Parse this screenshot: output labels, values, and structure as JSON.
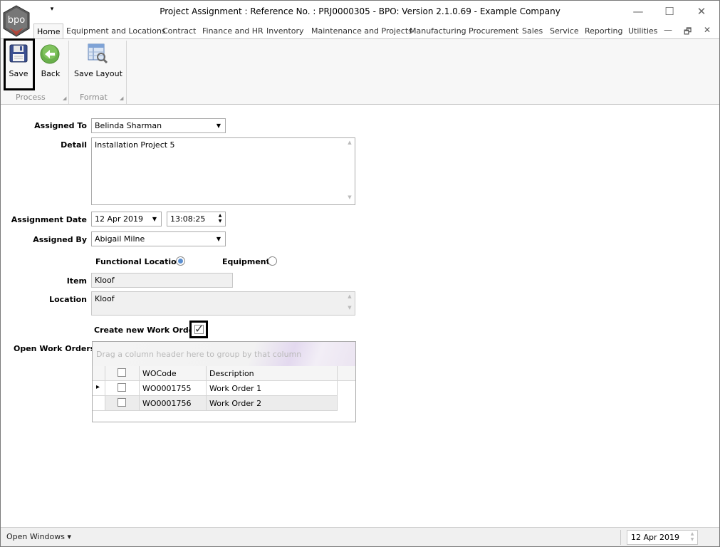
{
  "window": {
    "title": "Project Assignment : Reference No. : PRJ0000305 - BPO: Version 2.1.0.69 - Example Company",
    "logo_text": "bpo",
    "qat_arrow": "▾",
    "minimize": "—",
    "maximize": "☐",
    "close": "✕"
  },
  "tabs": [
    {
      "label": "Home"
    },
    {
      "label": "Equipment and Locations"
    },
    {
      "label": "Contract"
    },
    {
      "label": "Finance and HR"
    },
    {
      "label": "Inventory"
    },
    {
      "label": "Maintenance and Projects"
    },
    {
      "label": "Manufacturing"
    },
    {
      "label": "Procurement"
    },
    {
      "label": "Sales"
    },
    {
      "label": "Service"
    },
    {
      "label": "Reporting"
    },
    {
      "label": "Utilities"
    }
  ],
  "mdi_controls": {
    "minimize": "—",
    "restore": "🗗",
    "close": "✕"
  },
  "ribbon": {
    "save": "Save",
    "back": "Back",
    "save_layout": "Save Layout",
    "group_process": "Process",
    "group_format": "Format",
    "launcher": "◢"
  },
  "form": {
    "assigned_to_label": "Assigned To",
    "assigned_to_value": "Belinda Sharman",
    "detail_label": "Detail",
    "detail_value": "Installation Project 5",
    "assignment_date_label": "Assignment Date",
    "assignment_date_value": "12 Apr 2019",
    "assignment_time_value": "13:08:25",
    "assigned_by_label": "Assigned By",
    "assigned_by_value": "Abigail Milne",
    "functional_location_label": "Functional Location",
    "functional_location_selected": true,
    "equipment_label": "Equipment",
    "equipment_selected": false,
    "item_label": "Item",
    "item_value": "Kloof",
    "location_label": "Location",
    "location_value": "Kloof",
    "create_wo_label": "Create new Work Order",
    "create_wo_checked": true,
    "open_wo_label": "Open Work Orders",
    "dropdown_arrow": "▼",
    "spin_up": "▲",
    "spin_down": "▼",
    "scroll_up": "▲",
    "scroll_down": "▼",
    "tick": "✓"
  },
  "grid": {
    "group_panel_hint": "Drag a column header here to group by that column",
    "columns": [
      "WOCode",
      "Description"
    ],
    "row_indicator": "▸",
    "rows": [
      {
        "wocode": "WO0001755",
        "description": "Work Order 1",
        "checked": false
      },
      {
        "wocode": "WO0001756",
        "description": "Work Order 2",
        "checked": false
      }
    ]
  },
  "status_bar": {
    "open_windows": "Open Windows ▾",
    "date": "12 Apr 2019"
  },
  "colors": {
    "ribbon_bg": "#f7f7f7",
    "radio_on": "#5b8fd0",
    "logo_red": "#c0392b",
    "back_green": "#6ab04c"
  }
}
